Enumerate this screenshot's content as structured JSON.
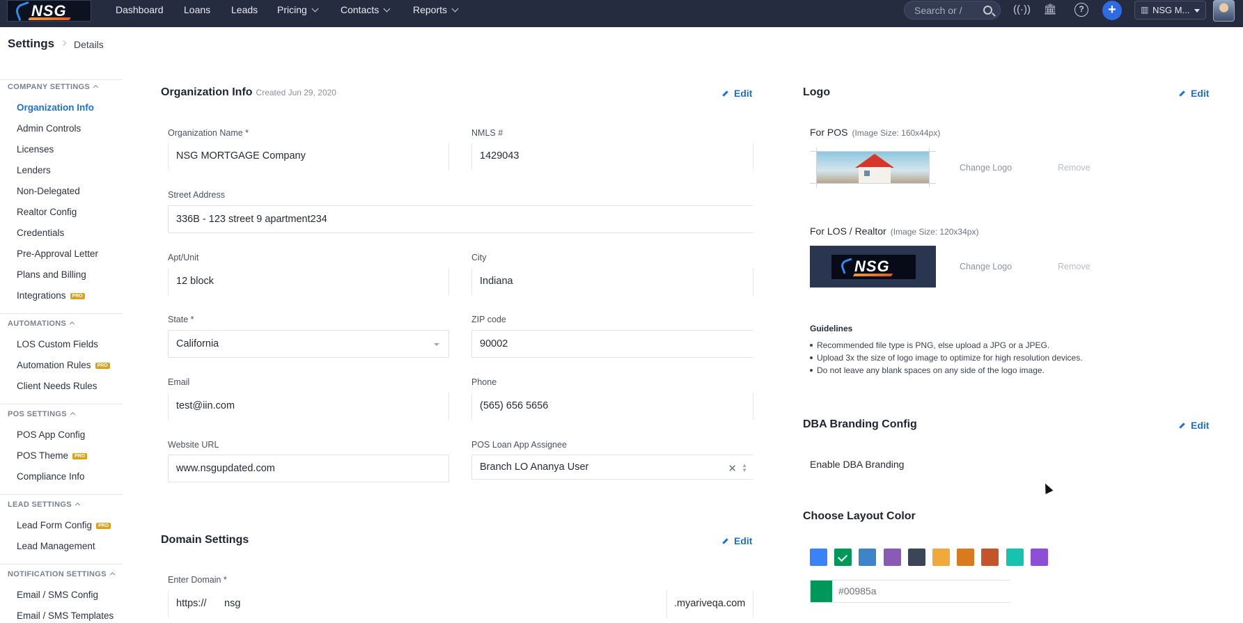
{
  "nav": {
    "logo_text": "NSG",
    "items": [
      "Dashboard",
      "Loans",
      "Leads",
      "Pricing",
      "Contacts",
      "Reports"
    ],
    "search_placeholder": "Search or /",
    "org_label": "NSG M...",
    "plus_label": "+"
  },
  "breadcrumb": {
    "title": "Settings",
    "current": "Details"
  },
  "sidebar": {
    "company_head": "COMPANY SETTINGS",
    "company_items": [
      "Organization Info",
      "Admin Controls",
      "Licenses",
      "Lenders",
      "Non-Delegated",
      "Realtor Config",
      "Credentials",
      "Pre-Approval Letter",
      "Plans and Billing",
      "Integrations"
    ],
    "automations_head": "AUTOMATIONS",
    "automations_items": [
      "LOS Custom Fields",
      "Automation Rules",
      "Client Needs Rules"
    ],
    "pos_head": "POS SETTINGS",
    "pos_items": [
      "POS App Config",
      "POS Theme",
      "Compliance Info"
    ],
    "lead_head": "LEAD SETTINGS",
    "lead_items": [
      "Lead Form Config",
      "Lead Management"
    ],
    "notification_head": "NOTIFICATION SETTINGS",
    "notification_items": [
      "Email / SMS Config",
      "Email / SMS Templates"
    ],
    "pro_badge": "PRO"
  },
  "org_info": {
    "title": "Organization Info",
    "created": "Created Jun 29, 2020",
    "edit": "Edit",
    "org_name_label": "Organization Name *",
    "org_name": "NSG MORTGAGE Company",
    "nmls_label": "NMLS #",
    "nmls": "1429043",
    "street_label": "Street Address",
    "street": "336B - 123 street 9 apartment234",
    "apt_label": "Apt/Unit",
    "apt": "12 block",
    "city_label": "City",
    "city": "Indiana",
    "state_label": "State *",
    "state": "California",
    "zip_label": "ZIP code",
    "zip": "90002",
    "email_label": "Email",
    "email": "test@iin.com",
    "phone_label": "Phone",
    "phone": "(565) 656 5656",
    "website_label": "Website URL",
    "website": "www.nsgupdated.com",
    "assignee_label": "POS Loan App Assignee",
    "assignee": "Branch LO Ananya User"
  },
  "domain": {
    "title": "Domain Settings",
    "edit": "Edit",
    "label": "Enter Domain *",
    "prefix": "https://",
    "value": "nsg",
    "suffix": ".myariveqa.com"
  },
  "logo": {
    "title": "Logo",
    "edit": "Edit",
    "pos_label": "For POS",
    "pos_note": "(Image Size: 160x44px)",
    "los_label": "For LOS / Realtor",
    "los_note": "(Image Size: 120x34px)",
    "change": "Change Logo",
    "remove": "Remove",
    "guidelines_title": "Guidelines",
    "guidelines": [
      "Recommended file type is PNG, else upload a JPG or a JPEG.",
      "Upload 3x the size of logo image to optimize for high resolution devices.",
      "Do not leave any blank spaces on any side of the logo image."
    ]
  },
  "dba": {
    "title": "DBA Branding Config",
    "edit": "Edit",
    "enable_label": "Enable DBA Branding"
  },
  "layout_color": {
    "title": "Choose Layout Color",
    "swatches": [
      "#3b82f6",
      "#00985a",
      "#3f84c8",
      "#8a5bb5",
      "#3a4558",
      "#f0a93a",
      "#d97a1e",
      "#c4552b",
      "#17c2b0",
      "#8e4fd6"
    ],
    "selected_index": 1,
    "hex_value": "#00985a"
  }
}
